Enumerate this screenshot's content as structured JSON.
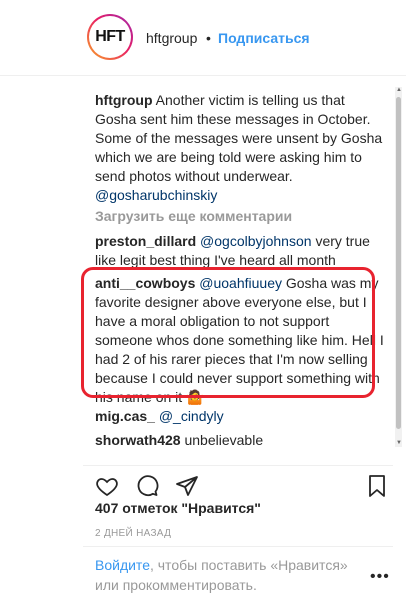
{
  "header": {
    "avatar_text": "HFT",
    "username": "hftgroup",
    "separator": "•",
    "follow_label": "Подписаться"
  },
  "caption": {
    "username": "hftgroup",
    "text": "Another victim is telling us that Gosha sent him these messages in October. Some of the messages were unsent by Gosha which we are being told were asking him to send photos without underwear.",
    "mention": "@gosharubchinskiy"
  },
  "load_more_label": "Загрузить еще комментарии",
  "comments": [
    {
      "username": "preston_dillard",
      "mention": "@ogcolbyjohnson",
      "text": "very true like legit best thing I've heard all month"
    },
    {
      "username": "anti__cowboys",
      "mention": "@uoahfiuuey",
      "text": "Gosha was my favorite designer above everyone else, but I have a moral obligation to not support someone whos done something like him. Hell I had 2 of his rarer pieces that I'm now selling because I could never support something with his name on it 🤷"
    },
    {
      "username": "mig.cas_",
      "mention": "@_cindyly",
      "text": ""
    },
    {
      "username": "shorwath428",
      "mention": "",
      "text": "unbelievable"
    }
  ],
  "likes_text": "407 отметок \"Нравится\"",
  "date_text": "2 ДНЕЙ НАЗАД",
  "login": {
    "link_label": "Войдите",
    "rest_text": ", чтобы поставить «Нравится» или прокомментировать."
  },
  "more_label": "•••",
  "colors": {
    "accent": "#3897f0",
    "highlight": "#e8232f",
    "mention": "#003569"
  }
}
